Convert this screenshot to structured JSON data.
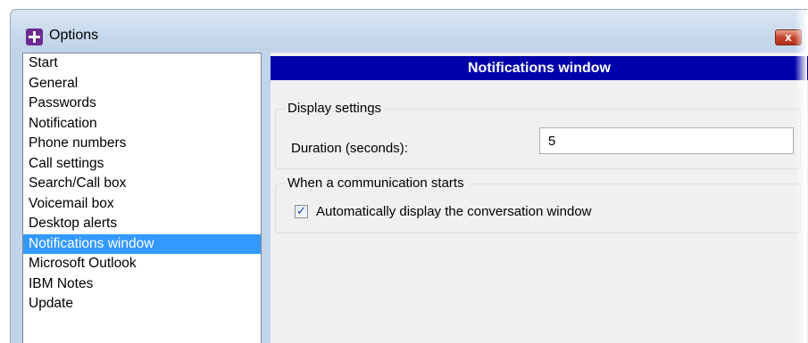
{
  "window": {
    "title": "Options",
    "close_glyph": "x"
  },
  "sidebar": {
    "items": [
      {
        "label": "Start",
        "selected": false
      },
      {
        "label": "General",
        "selected": false
      },
      {
        "label": "Passwords",
        "selected": false
      },
      {
        "label": "Notification",
        "selected": false
      },
      {
        "label": "Phone numbers",
        "selected": false
      },
      {
        "label": "Call settings",
        "selected": false
      },
      {
        "label": "Search/Call box",
        "selected": false
      },
      {
        "label": "Voicemail box",
        "selected": false
      },
      {
        "label": "Desktop alerts",
        "selected": false
      },
      {
        "label": "Notifications window",
        "selected": true
      },
      {
        "label": "Microsoft Outlook",
        "selected": false
      },
      {
        "label": "IBM Notes",
        "selected": false
      },
      {
        "label": "Update",
        "selected": false
      }
    ]
  },
  "main": {
    "header": "Notifications window",
    "display_settings": {
      "legend": "Display settings",
      "duration_label": "Duration (seconds):",
      "duration_value": "5"
    },
    "communication": {
      "legend": "When a communication starts",
      "auto_display_label": "Automatically display the conversation window",
      "auto_display_checked": true,
      "check_glyph": "✓"
    }
  },
  "colors": {
    "header_bg": "#0000aa",
    "selection_bg": "#3399ff",
    "close_button": "#c7432b"
  }
}
